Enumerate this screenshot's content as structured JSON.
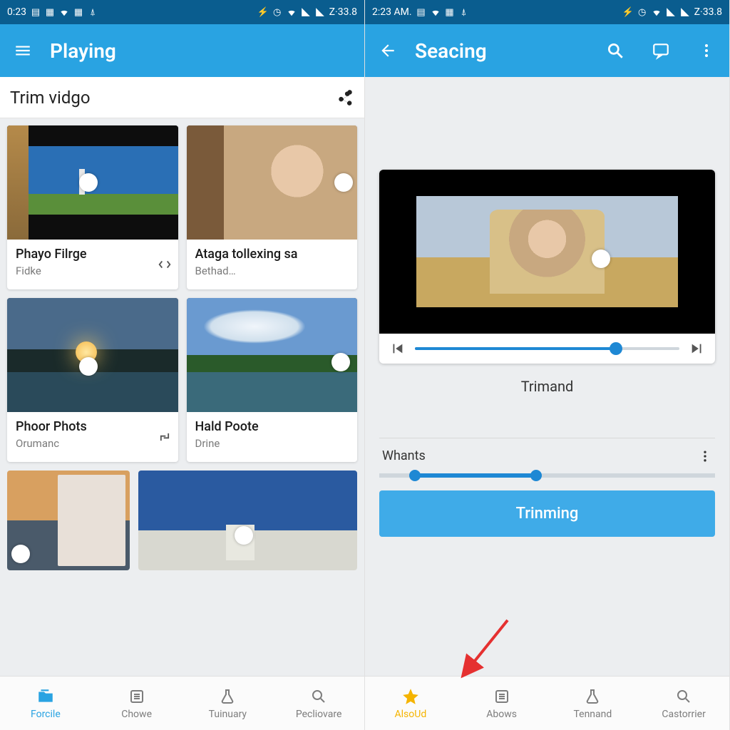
{
  "left": {
    "status": {
      "time": "0:23",
      "battery": "33.8"
    },
    "appbar": {
      "title": "Playing"
    },
    "section": {
      "title": "Trim vidgo"
    },
    "videos": [
      {
        "title": "Phayo Filrge",
        "sub": "Fidke"
      },
      {
        "title": "Ataga tollexing sa",
        "sub": "Bethad…"
      },
      {
        "title": "Phoor Phots",
        "sub": "Orumanc"
      },
      {
        "title": "Hald Poote",
        "sub": "Drine"
      }
    ],
    "nav": [
      {
        "label": "Forcile"
      },
      {
        "label": "Chowe"
      },
      {
        "label": "Tuinuary"
      },
      {
        "label": "Pecliovare"
      }
    ]
  },
  "right": {
    "status": {
      "time": "2:23 AM.",
      "battery": "33.8"
    },
    "appbar": {
      "title": "Seacing"
    },
    "trim_label": "Trimand",
    "option_label": "Whants",
    "action_button": "Trinming",
    "nav": [
      {
        "label": "AlsoUd"
      },
      {
        "label": "Abows"
      },
      {
        "label": "Tennand"
      },
      {
        "label": "Castorrier"
      }
    ]
  }
}
